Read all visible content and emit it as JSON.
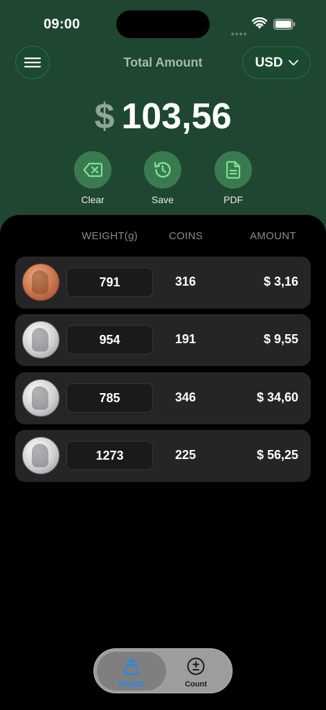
{
  "status_bar": {
    "time": "09:00"
  },
  "header": {
    "title": "Total Amount",
    "currency": "USD",
    "total_symbol": "$",
    "total_value": "103,56"
  },
  "actions": [
    {
      "label": "Clear",
      "icon": "backspace-icon"
    },
    {
      "label": "Save",
      "icon": "history-icon"
    },
    {
      "label": "PDF",
      "icon": "document-icon"
    }
  ],
  "table": {
    "headers": {
      "weight": "WEIGHT(g)",
      "coins": "COINS",
      "amount": "AMOUNT"
    },
    "rows": [
      {
        "coin": "penny",
        "weight": "791",
        "coins": "316",
        "amount": "$ 3,16"
      },
      {
        "coin": "nickel",
        "weight": "954",
        "coins": "191",
        "amount": "$ 9,55"
      },
      {
        "coin": "dime",
        "weight": "785",
        "coins": "346",
        "amount": "$ 34,60"
      },
      {
        "coin": "quarter",
        "weight": "1273",
        "coins": "225",
        "amount": "$ 56,25"
      }
    ]
  },
  "tabs": [
    {
      "label": "Weight",
      "icon": "scale-icon",
      "active": true
    },
    {
      "label": "Count",
      "icon": "plus-minus-icon",
      "active": false
    }
  ],
  "colors": {
    "header_bg": "#1f4630",
    "action_bg": "#3b7a4f",
    "row_bg": "#252527",
    "active_tab": "#2c86e6"
  }
}
